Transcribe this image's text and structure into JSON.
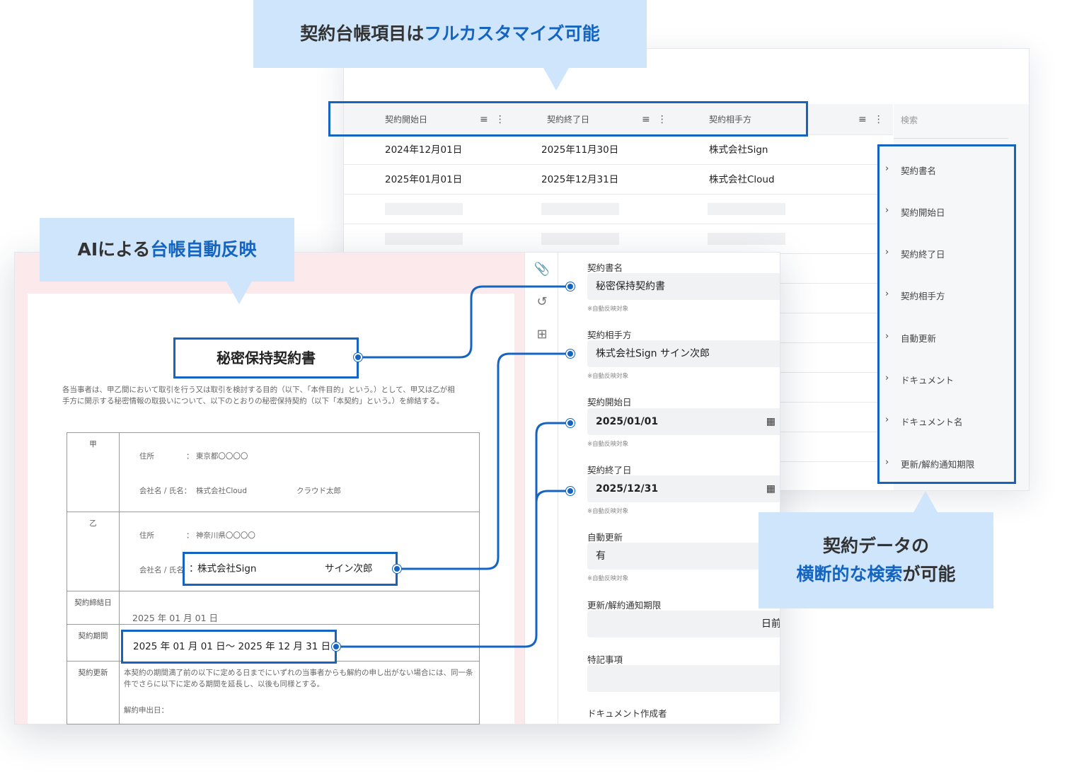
{
  "callouts": {
    "top": {
      "plain": "契約台帳項目は",
      "highlight": "フルカスタマイズ可能"
    },
    "left": {
      "plain": "AIによる",
      "highlight": "台帳自動反映"
    },
    "right": {
      "line1": "契約データの",
      "highlight": "横断的な検索",
      "line2_rest": "が可能"
    }
  },
  "table": {
    "columns": [
      "契約開始日",
      "契約終了日",
      "契約相手方"
    ],
    "rows": [
      [
        "2024年12月01日",
        "2025年11月30日",
        "株式会社Sign"
      ],
      [
        "2025年01月01日",
        "2025年12月31日",
        "株式会社Cloud"
      ]
    ],
    "search_label": "検索",
    "search_fields": [
      "契約書名",
      "契約開始日",
      "契約終了日",
      "契約相手方",
      "自動更新",
      "ドキュメント",
      "ドキュメント名",
      "更新/解約通知期限"
    ]
  },
  "document": {
    "title": "秘密保持契約書",
    "intro": "各当事者は、甲乙間において取引を行う又は取引を検討する目的（以下、「本件目的」という。）として、甲又は乙が相手方に開示する秘密情報の取扱いについて、以下のとおりの秘密保持契約（以下「本契約」という。）を締結する。",
    "party_a": {
      "label": "甲",
      "address_label": "住所",
      "address": "：  東京都〇〇〇〇",
      "name_label": "会社名 / 氏名：",
      "company": "株式会社Cloud",
      "person": "クラウド太郎"
    },
    "party_b": {
      "label": "乙",
      "address_label": "住所",
      "address": "：  神奈川県〇〇〇〇",
      "name_label": "会社名 / 氏名",
      "company_person_prefix": "：",
      "company": "株式会社Sign",
      "person": "サイン次郎"
    },
    "signed_label": "契約締結日",
    "signed_date": "2025 年 01 月 01 日",
    "period_label": "契約期間",
    "period": "2025 年 01 月 01 日〜 2025 年 12 月 31 日",
    "renewal_label": "契約更新",
    "renewal_text": "本契約の期間満了前の以下に定める日までにいずれの当事者からも解約の申し出がない場合には、同一条件でさらに以下に定める期間を延長し、以後も同様とする。",
    "cancel_label": "解約申出日："
  },
  "form": {
    "note": "※自動反映対象",
    "fields": [
      {
        "label": "契約書名",
        "value": "秘密保持契約書"
      },
      {
        "label": "契約相手方",
        "value": "株式会社Sign サイン次郎"
      },
      {
        "label": "契約開始日",
        "value": "2025/01/01"
      },
      {
        "label": "契約終了日",
        "value": "2025/12/31"
      },
      {
        "label": "自動更新",
        "value": "有"
      },
      {
        "label": "更新/解約通知期限",
        "value": "",
        "suffix": "日前"
      },
      {
        "label": "特記事項",
        "value": ""
      },
      {
        "label": "ドキュメント作成者",
        "value": ""
      }
    ]
  },
  "colors": {
    "accent": "#1565c0",
    "callout_bg": "#cfe5fb",
    "doc_bg": "#fbe9ec"
  }
}
